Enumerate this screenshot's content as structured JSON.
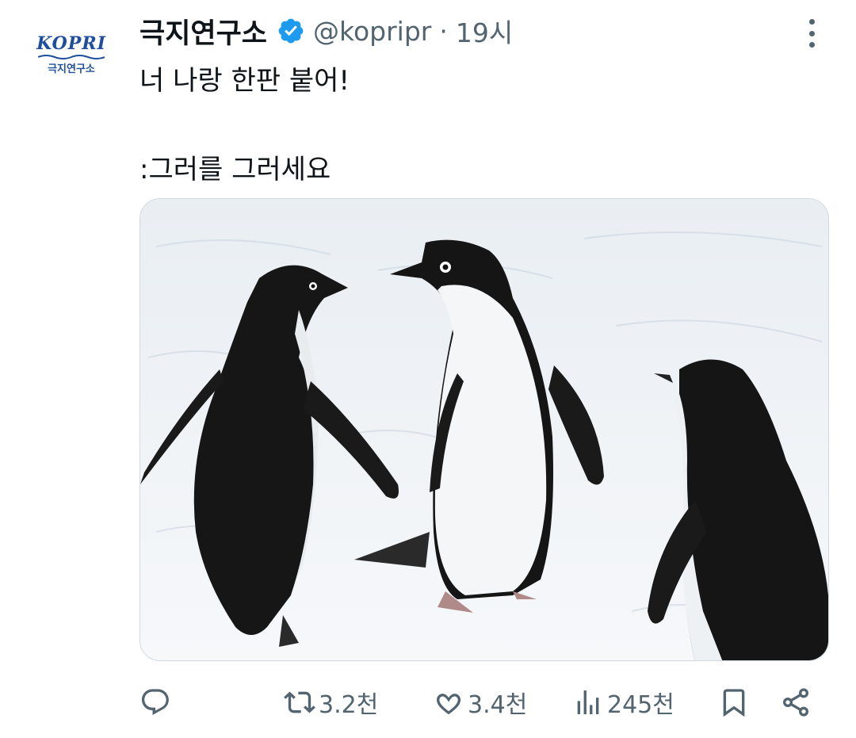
{
  "tweet": {
    "author_name": "극지연구소",
    "handle": "@kopripr",
    "separator": "·",
    "time": "19시",
    "text_line1": "너 나랑 한판 붙어!",
    "text_line2": ":그러를 그러세요"
  },
  "avatar": {
    "logo_word": "KOPRI",
    "logo_kr": "극지연구소",
    "brand_color": "#1f4e9c"
  },
  "actions": {
    "reply_icon": "reply-icon",
    "retweet_count": "3.2천",
    "like_count": "3.4천",
    "views_count": "245천",
    "bookmark_icon": "bookmark-icon",
    "share_icon": "share-icon"
  },
  "colors": {
    "verified": "#1d9bf0",
    "text_secondary": "#536471",
    "text_primary": "#0f1419"
  },
  "media": {
    "subject": "three penguins on snow"
  }
}
